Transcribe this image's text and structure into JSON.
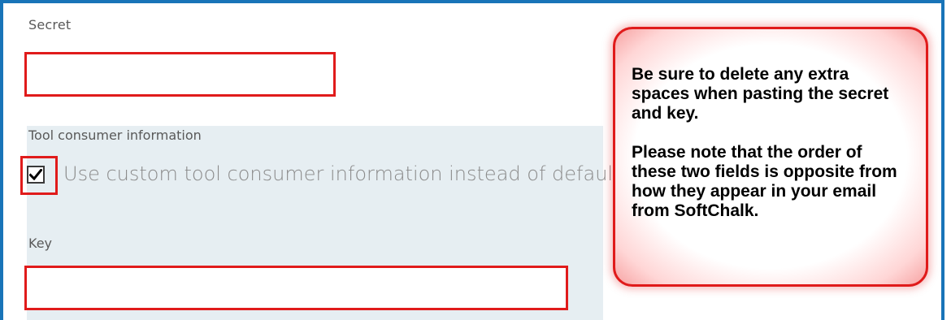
{
  "form": {
    "secret_label": "Secret",
    "secret_value": "",
    "consumer_section_label": "Tool consumer information",
    "custom_info_checkbox": {
      "label": "Use custom tool consumer information instead of default",
      "checked": true
    },
    "key_label": "Key",
    "key_value": ""
  },
  "callout": {
    "paragraph_1": "Be sure to delete any extra spaces when pasting the secret and key.",
    "paragraph_2": "Please note that the order of these two fields is opposite from how they appear in your email from SoftChalk."
  },
  "colors": {
    "frame_border": "#1874b8",
    "highlight_red": "#e01b1b",
    "panel_background": "#e6eef2"
  },
  "icons": {
    "checkbox": "checkmark-icon"
  }
}
